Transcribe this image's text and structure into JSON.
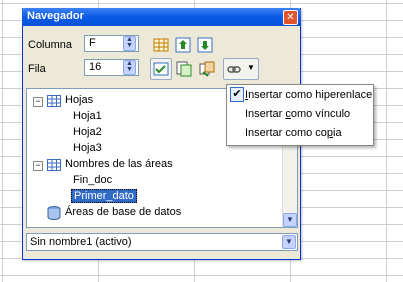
{
  "window": {
    "title": "Navegador",
    "close_glyph": "✕"
  },
  "fields": {
    "column_label": "Columna",
    "column_value": "F",
    "row_label": "Fila",
    "row_value": "16"
  },
  "tree": {
    "sheets_label": "Hojas",
    "sheets": [
      "Hoja1",
      "Hoja2",
      "Hoja3"
    ],
    "areas_label": "Nombres de las áreas",
    "areas": [
      "Fin_doc",
      "Primer_dato"
    ],
    "db_label": "Áreas de base de datos"
  },
  "document_select": "Sin nombre1 (activo)",
  "menu": {
    "items": [
      {
        "before": "",
        "key": "I",
        "after": "nsertar como hiperenlace",
        "checked": true
      },
      {
        "before": "Insertar ",
        "key": "c",
        "after": "omo vínculo",
        "checked": false
      },
      {
        "before": "Insertar como co",
        "key": "p",
        "after": "ia",
        "checked": false
      }
    ]
  },
  "colors": {
    "titlebar": "#0a5ae6",
    "selection": "#316ac5",
    "accent": "#c3d3fd"
  }
}
